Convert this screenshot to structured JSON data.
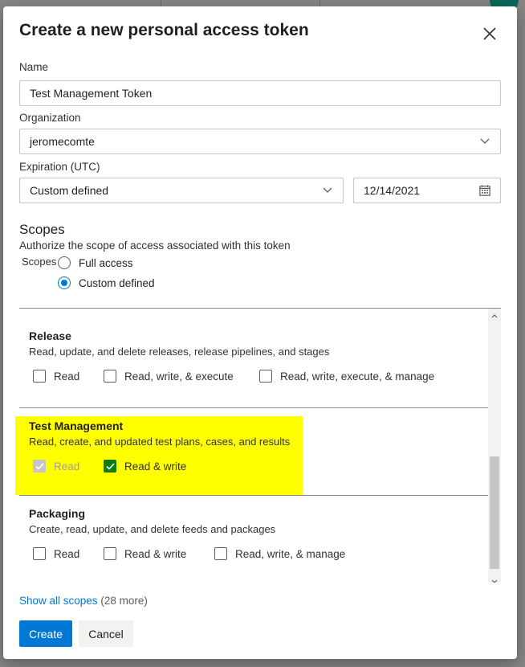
{
  "dialog": {
    "title": "Create a new personal access token",
    "name": {
      "label": "Name",
      "value": "Test Management Token"
    },
    "organization": {
      "label": "Organization",
      "value": "jeromecomte"
    },
    "expiration": {
      "label": "Expiration (UTC)",
      "value": "Custom defined",
      "date": "12/14/2021"
    },
    "scopes": {
      "heading": "Scopes",
      "description": "Authorize the scope of access associated with this token",
      "radio_group_label": "Scopes",
      "options": [
        {
          "label": "Full access",
          "checked": false
        },
        {
          "label": "Custom defined",
          "checked": true
        }
      ]
    },
    "scope_groups": [
      {
        "name": "Release",
        "description": "Read, update, and delete releases, release pipelines, and stages",
        "permissions": [
          {
            "label": "Read",
            "checked": false,
            "disabled": false
          },
          {
            "label": "Read, write, & execute",
            "checked": false,
            "disabled": false
          },
          {
            "label": "Read, write, execute, & manage",
            "checked": false,
            "disabled": false
          }
        ]
      },
      {
        "name": "Test Management",
        "description": "Read, create, and updated test plans, cases, and results",
        "permissions": [
          {
            "label": "Read",
            "checked": true,
            "disabled": true
          },
          {
            "label": "Read & write",
            "checked": true,
            "disabled": false
          }
        ]
      },
      {
        "name": "Packaging",
        "description": "Create, read, update, and delete feeds and packages",
        "permissions": [
          {
            "label": "Read",
            "checked": false,
            "disabled": false
          },
          {
            "label": "Read & write",
            "checked": false,
            "disabled": false
          },
          {
            "label": "Read, write, & manage",
            "checked": false,
            "disabled": false
          }
        ]
      }
    ],
    "show_all": {
      "link": "Show all scopes",
      "count": "(28 more)"
    },
    "buttons": {
      "create": "Create",
      "cancel": "Cancel"
    }
  },
  "colors": {
    "accent": "#0078d4",
    "checked_green": "#107c10",
    "highlight": "#ffff00"
  }
}
